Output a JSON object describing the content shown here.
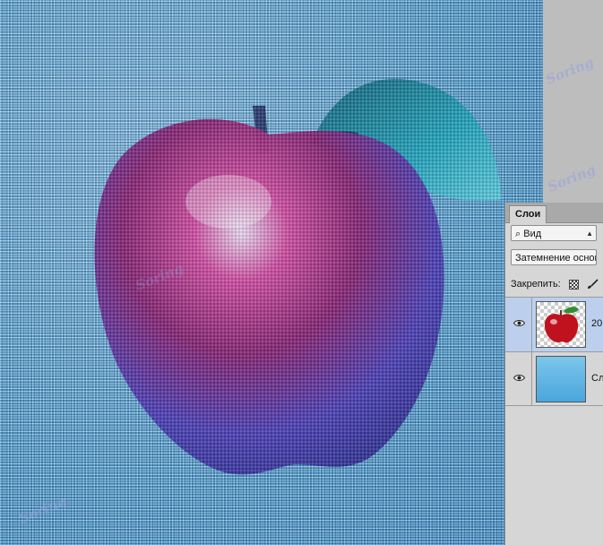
{
  "artwork": {
    "watermark_text": "Soring"
  },
  "layers_panel": {
    "tab_label": "Слои",
    "filter": {
      "icon": "search-icon",
      "value": "Вид"
    },
    "blend_mode": {
      "value": "Затемнение основы"
    },
    "lock": {
      "label": "Закрепить:"
    },
    "layers": [
      {
        "name": "20",
        "visible": true,
        "selected": true,
        "thumbnail": "red apple"
      },
      {
        "name": "Сл",
        "visible": true,
        "selected": false,
        "thumbnail": "blue gradient"
      }
    ]
  },
  "colors": {
    "canvas_blue": "#5fb8e0",
    "apple_red": "#9a1f66",
    "apple_violet": "#3b2a9a",
    "leaf_teal": "#1aa7b8",
    "panel_bg": "#d6d6d6",
    "selected_layer": "#bcd0ee"
  }
}
